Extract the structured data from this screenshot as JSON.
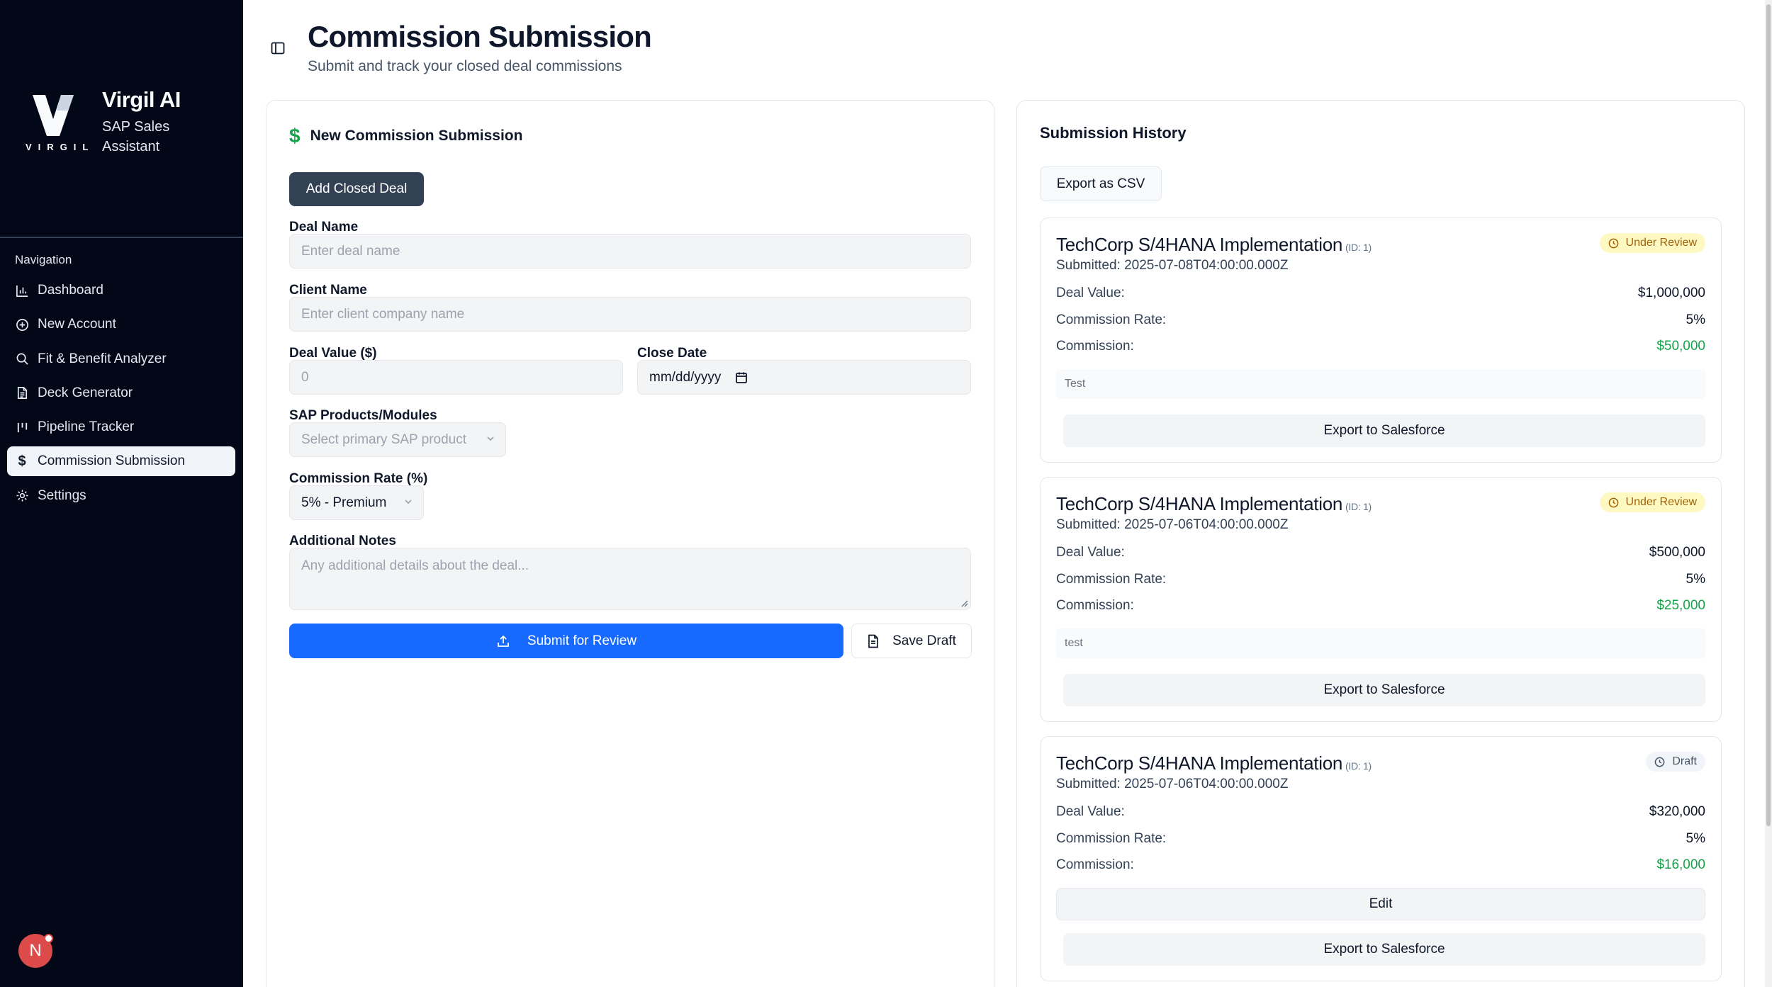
{
  "brand": {
    "logo_word": "VIRGIL",
    "title": "Virgil AI",
    "subtitle": "SAP Sales Assistant"
  },
  "navigation": {
    "heading": "Navigation",
    "items": [
      {
        "label": "Dashboard",
        "icon": "bar-chart-icon",
        "active": false
      },
      {
        "label": "New Account",
        "icon": "plus-circle-icon",
        "active": false
      },
      {
        "label": "Fit & Benefit Analyzer",
        "icon": "search-icon",
        "active": false
      },
      {
        "label": "Deck Generator",
        "icon": "file-text-icon",
        "active": false
      },
      {
        "label": "Pipeline Tracker",
        "icon": "kanban-icon",
        "active": false
      },
      {
        "label": "Commission Submission",
        "icon": "dollar-icon",
        "active": true
      },
      {
        "label": "Settings",
        "icon": "gear-icon",
        "active": false
      }
    ]
  },
  "user": {
    "initial": "N"
  },
  "header": {
    "title": "Commission Submission",
    "subtitle": "Submit and track your closed deal commissions"
  },
  "form": {
    "title": "New Commission Submission",
    "add_closed_deal": "Add Closed Deal",
    "deal_name": {
      "label": "Deal Name",
      "placeholder": "Enter deal name"
    },
    "client_name": {
      "label": "Client Name",
      "placeholder": "Enter client company name"
    },
    "deal_value": {
      "label": "Deal Value ($)",
      "placeholder": "0"
    },
    "close_date": {
      "label": "Close Date",
      "placeholder": "mm/dd/yyyy"
    },
    "sap_products": {
      "label": "SAP Products/Modules",
      "placeholder": "Select primary SAP product"
    },
    "commission_rate": {
      "label": "Commission Rate (%)",
      "value": "5% - Premium"
    },
    "notes": {
      "label": "Additional Notes",
      "placeholder": "Any additional details about the deal..."
    },
    "submit": "Submit for Review",
    "save_draft": "Save Draft"
  },
  "history": {
    "title": "Submission History",
    "export_csv": "Export as CSV",
    "labels": {
      "deal_value": "Deal Value:",
      "commission_rate": "Commission Rate:",
      "commission": "Commission:",
      "export_salesforce": "Export to Salesforce",
      "edit": "Edit"
    },
    "items": [
      {
        "title": "TechCorp S/4HANA Implementation",
        "id": "(ID: 1)",
        "submitted": "Submitted: 2025-07-08T04:00:00.000Z",
        "status": "Under Review",
        "deal_value": "$1,000,000",
        "rate": "5%",
        "commission": "$50,000",
        "note": "Test"
      },
      {
        "title": "TechCorp S/4HANA Implementation",
        "id": "(ID: 1)",
        "submitted": "Submitted: 2025-07-06T04:00:00.000Z",
        "status": "Under Review",
        "deal_value": "$500,000",
        "rate": "5%",
        "commission": "$25,000",
        "note": "test"
      },
      {
        "title": "TechCorp S/4HANA Implementation",
        "id": "(ID: 1)",
        "submitted": "Submitted: 2025-07-06T04:00:00.000Z",
        "status": "Draft",
        "deal_value": "$320,000",
        "rate": "5%",
        "commission": "$16,000"
      }
    ]
  },
  "colors": {
    "sidebar_bg": "#020817",
    "primary": "#1769ff",
    "positive": "#16a34a",
    "review_badge": "#fef9c3"
  }
}
